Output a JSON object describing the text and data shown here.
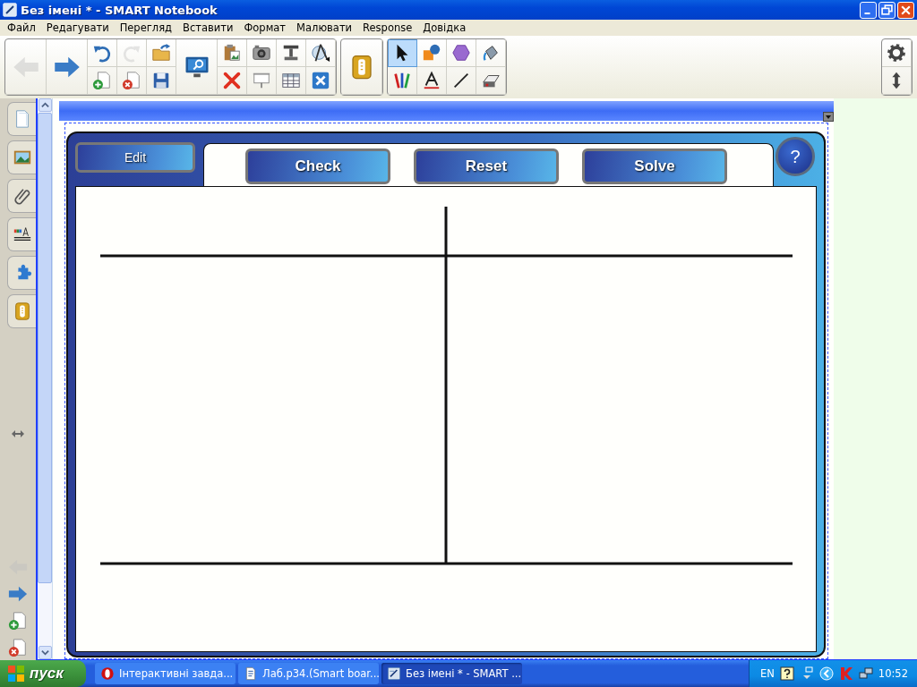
{
  "window": {
    "title": "Без імені * - SMART Notebook"
  },
  "menu": [
    "Файл",
    "Редагувати",
    "Перегляд",
    "Вставити",
    "Формат",
    "Малювати",
    "Response",
    "Довідка"
  ],
  "toolbar": {
    "main": [
      {
        "kind": "back",
        "disabled": true
      },
      {
        "kind": "forward",
        "disabled": false
      },
      {
        "kind": "undo",
        "disabled": false
      },
      {
        "kind": "add-page",
        "disabled": false
      },
      {
        "kind": "redo",
        "disabled": true
      },
      {
        "kind": "delete-page",
        "disabled": false
      },
      {
        "kind": "open",
        "disabled": false
      },
      {
        "kind": "save",
        "disabled": false
      },
      {
        "kind": "screen-shade",
        "disabled": false
      },
      {
        "kind": "paste",
        "disabled": false
      },
      {
        "kind": "delete",
        "disabled": false
      },
      {
        "kind": "camera",
        "disabled": false
      },
      {
        "kind": "presentation",
        "disabled": false
      },
      {
        "kind": "doc-camera",
        "disabled": false
      },
      {
        "kind": "table",
        "disabled": false
      },
      {
        "kind": "measure",
        "disabled": false
      },
      {
        "kind": "full-screen",
        "disabled": false
      }
    ],
    "response": [
      {
        "kind": "response"
      }
    ],
    "tools": [
      {
        "kind": "select",
        "selected": true
      },
      {
        "kind": "pens",
        "selected": false
      },
      {
        "kind": "shapes",
        "selected": false
      },
      {
        "kind": "text",
        "selected": false
      },
      {
        "kind": "polygon",
        "selected": false
      },
      {
        "kind": "line",
        "selected": false
      },
      {
        "kind": "fill",
        "selected": false
      },
      {
        "kind": "eraser",
        "selected": false
      }
    ],
    "extra": [
      {
        "kind": "settings"
      },
      {
        "kind": "move"
      }
    ]
  },
  "sidebar": {
    "tabs": [
      {
        "kind": "page"
      },
      {
        "kind": "gallery"
      },
      {
        "kind": "attachment"
      },
      {
        "kind": "properties"
      },
      {
        "kind": "addon"
      },
      {
        "kind": "response"
      }
    ],
    "nav": [
      {
        "kind": "back",
        "disabled": true
      },
      {
        "kind": "forward",
        "disabled": false
      },
      {
        "kind": "add-page",
        "disabled": false
      },
      {
        "kind": "delete-page",
        "disabled": false
      }
    ]
  },
  "widget": {
    "edit": "Edit",
    "buttons": [
      "Check",
      "Reset",
      "Solve"
    ],
    "help": "?"
  },
  "taskbar": {
    "start": "пуск",
    "tasks": [
      {
        "kind": "opera",
        "label": "Інтерактивні завда...",
        "selected": false
      },
      {
        "kind": "word",
        "label": "Лаб.р34.(Smart boar...",
        "selected": false
      },
      {
        "kind": "notebook",
        "label": "Без імені * - SMART ...",
        "selected": true
      }
    ],
    "language": "EN",
    "time": "10:52"
  }
}
